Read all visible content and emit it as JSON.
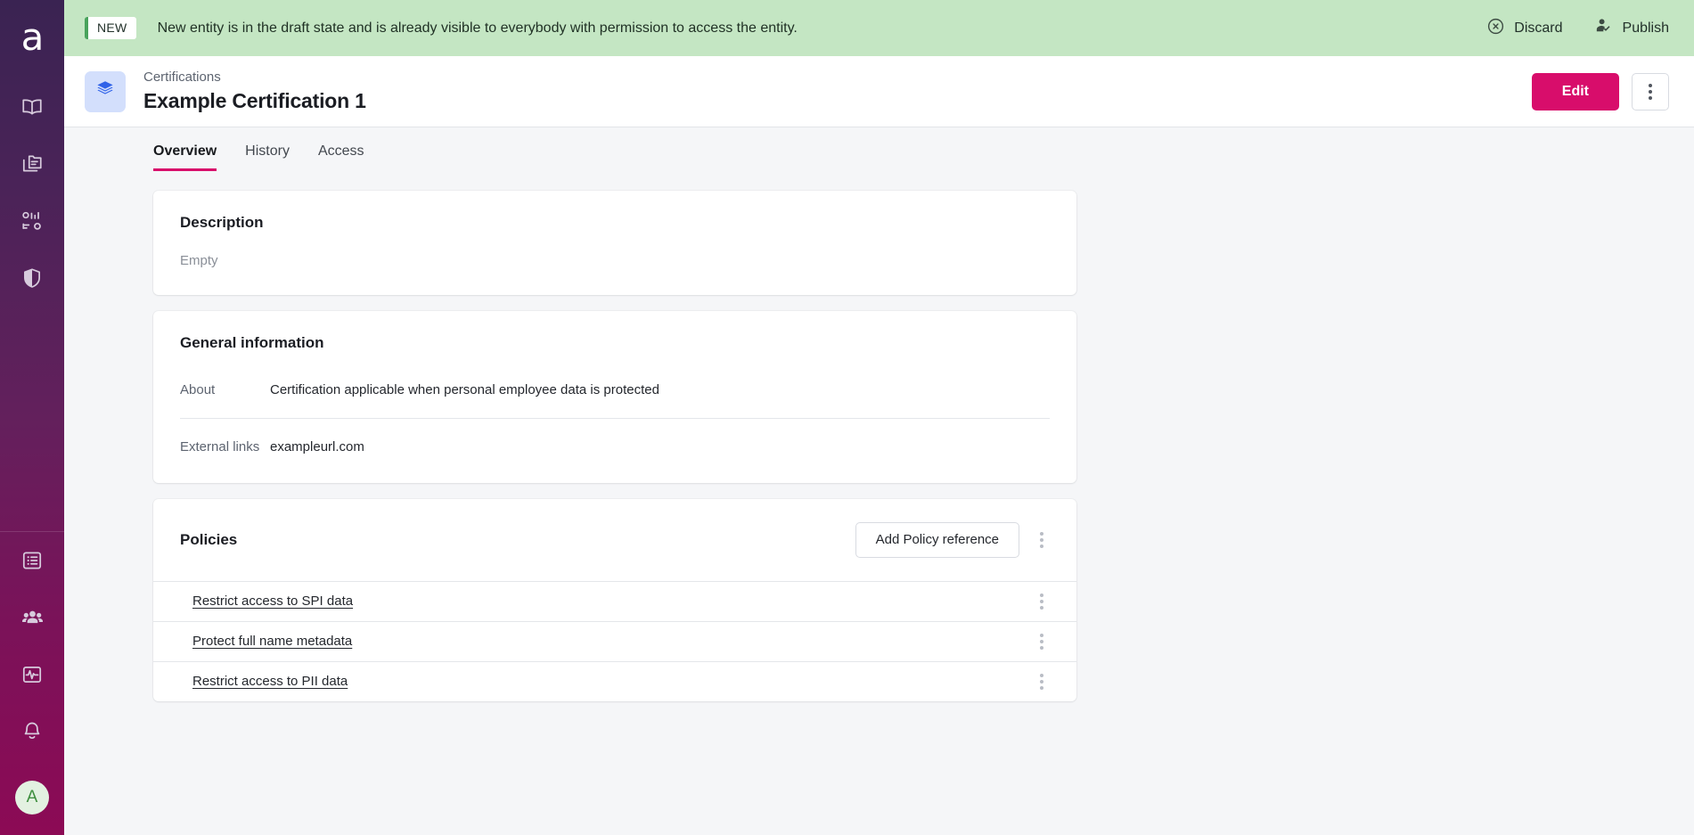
{
  "sidebar": {
    "logo": {
      "name": "app-logo",
      "text": "a"
    },
    "top_items": [
      {
        "icon": "book-icon",
        "name": "glossary"
      },
      {
        "icon": "folder-copy-icon",
        "name": "catalog"
      },
      {
        "icon": "dashboard-icon",
        "name": "data-products"
      },
      {
        "icon": "shield-icon",
        "name": "governance"
      }
    ],
    "bottom_items": [
      {
        "icon": "list-icon",
        "name": "tasks"
      },
      {
        "icon": "people-icon",
        "name": "users"
      },
      {
        "icon": "monitoring-icon",
        "name": "monitoring"
      },
      {
        "icon": "bell-icon",
        "name": "notifications"
      }
    ],
    "avatar": {
      "initial": "A",
      "name": "user-avatar"
    }
  },
  "banner": {
    "badge": "NEW",
    "message": "New entity is in the draft state and is already visible to everybody with permission to access the entity.",
    "discard_label": "Discard",
    "publish_label": "Publish",
    "background": "#c4e6c3",
    "badge_accent": "#49a35c"
  },
  "header": {
    "breadcrumb": "Certifications",
    "title": "Example Certification 1",
    "entity_icon": "layers-icon",
    "edit_label": "Edit",
    "edit_color": "#d80d6b",
    "more_icon": "kebab-menu-icon"
  },
  "tabs": [
    {
      "label": "Overview",
      "active": true
    },
    {
      "label": "History",
      "active": false
    },
    {
      "label": "Access",
      "active": false
    }
  ],
  "description_card": {
    "title": "Description",
    "value": "Empty"
  },
  "general_information": {
    "title": "General information",
    "rows": [
      {
        "label": "About",
        "value": "Certification applicable when personal employee data is protected"
      },
      {
        "label": "External links",
        "value": "exampleurl.com"
      }
    ]
  },
  "policies": {
    "title": "Policies",
    "add_label": "Add Policy reference",
    "items": [
      {
        "label": "Restrict access to SPI data"
      },
      {
        "label": "Protect full name metadata"
      },
      {
        "label": "Restrict access to PII data"
      }
    ]
  }
}
